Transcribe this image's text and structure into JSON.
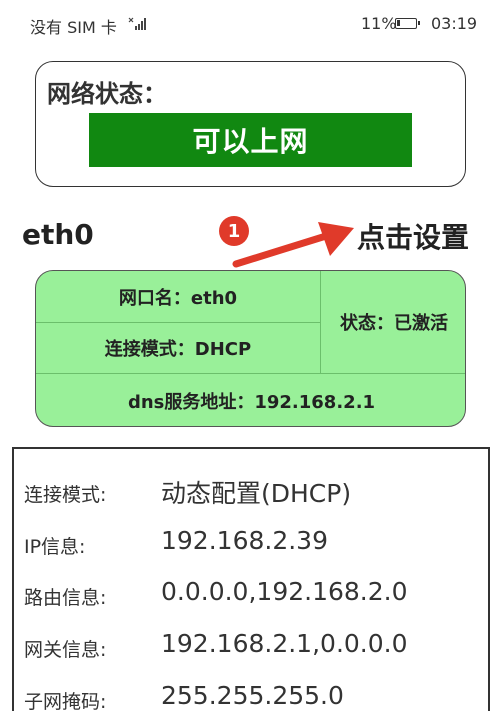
{
  "status_bar": {
    "carrier": "没有 SIM 卡",
    "battery_percent": "11%",
    "time": "03:19"
  },
  "network_card": {
    "title": "网络状态：",
    "status": "可以上网",
    "status_color": "#118811"
  },
  "interface": {
    "name": "eth0",
    "step_number": "1",
    "settings_link": "点击设置"
  },
  "info_card": {
    "port_name": "网口名：eth0",
    "connection_mode": "连接模式：DHCP",
    "state": "状态：已激活",
    "dns": "dns服务地址：192.168.2.1",
    "background_color": "#99f099"
  },
  "details": [
    {
      "label": "连接模式:",
      "value": "动态配置(DHCP)"
    },
    {
      "label": "IP信息:",
      "value": "192.168.2.39"
    },
    {
      "label": "路由信息:",
      "value": "0.0.0.0,192.168.2.0"
    },
    {
      "label": "网关信息:",
      "value": "192.168.2.1,0.0.0.0"
    },
    {
      "label": "子网掩码:",
      "value": "255.255.255.0"
    }
  ]
}
